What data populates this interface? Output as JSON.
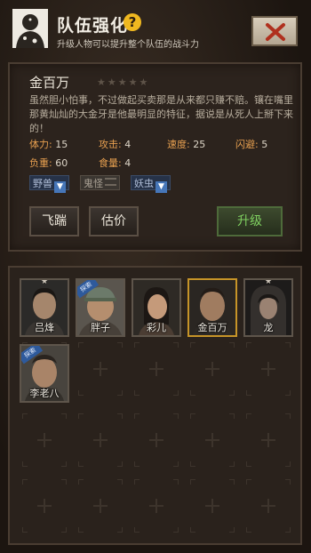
{
  "header": {
    "title": "队伍强化",
    "help_glyph": "?",
    "subtitle": "升级人物可以提升整个队伍的战斗力"
  },
  "hero": {
    "name": "金百万",
    "stars": "★★★★★",
    "description": "虽然胆小怕事，不过做起买卖那是从来都只赚不赔。镶在嘴里那黄灿灿的大金牙是他最明显的特征，据说是从死人上掰下来的！",
    "stats": {
      "hp_label": "体力:",
      "hp": "15",
      "atk_label": "攻击:",
      "atk": "4",
      "spd_label": "速度:",
      "spd": "25",
      "eva_label": "闪避:",
      "eva": "5",
      "load_label": "负重:",
      "load": "60",
      "food_label": "食量:",
      "food": "4"
    },
    "tags": [
      "野兽",
      "鬼怪",
      "妖虫"
    ]
  },
  "buttons": {
    "kick": "飞踹",
    "appraise": "估价",
    "upgrade": "升级"
  },
  "roster": {
    "members": [
      {
        "name": "吕烽",
        "badge": "",
        "star": "★"
      },
      {
        "name": "胖子",
        "badge": "探索",
        "star": ""
      },
      {
        "name": "彩儿",
        "badge": "",
        "star": ""
      },
      {
        "name": "金百万",
        "badge": "",
        "star": ""
      },
      {
        "name": "龙",
        "badge": "",
        "star": "★"
      },
      {
        "name": "李老八",
        "badge": "探索",
        "star": ""
      }
    ]
  },
  "colors": {
    "accent": "#e8a050",
    "selected_border": "#c69428",
    "upgrade_text": "#7fd060",
    "badge_blue": "#2e5a9c"
  }
}
